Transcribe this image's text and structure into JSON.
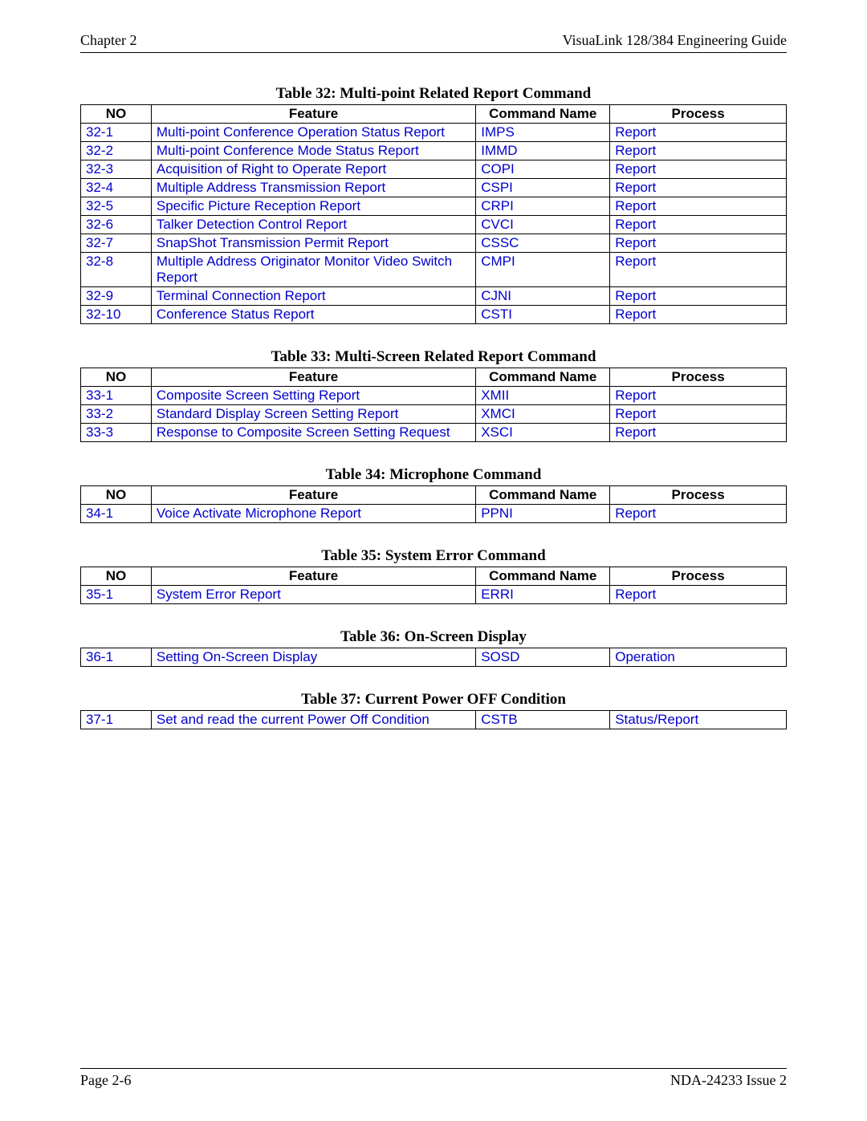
{
  "header": {
    "left": "Chapter 2",
    "right": "VisuaLink 128/384 Engineering Guide"
  },
  "footer": {
    "left": "Page 2-6",
    "right": "NDA-24233 Issue 2"
  },
  "columns": {
    "no": "NO",
    "feature": "Feature",
    "cmd": "Command Name",
    "proc": "Process"
  },
  "tables": [
    {
      "caption": "Table 32:  Multi-point Related Report Command",
      "show_header": true,
      "rows": [
        {
          "no": "32-1",
          "feature": "Multi-point Conference Operation Status Report",
          "cmd": "IMPS",
          "proc": "Report"
        },
        {
          "no": "32-2",
          "feature": "Multi-point Conference Mode Status Report",
          "cmd": "IMMD",
          "proc": "Report"
        },
        {
          "no": "32-3",
          "feature": "Acquisition of Right to Operate Report",
          "cmd": "COPI",
          "proc": "Report"
        },
        {
          "no": "32-4",
          "feature": "Multiple Address Transmission Report",
          "cmd": "CSPI",
          "proc": "Report"
        },
        {
          "no": "32-5",
          "feature": "Specific Picture Reception Report",
          "cmd": "CRPI",
          "proc": "Report"
        },
        {
          "no": "32-6",
          "feature": "Talker Detection Control Report",
          "cmd": "CVCI",
          "proc": "Report"
        },
        {
          "no": "32-7",
          "feature": "SnapShot Transmission Permit Report",
          "cmd": "CSSC",
          "proc": "Report"
        },
        {
          "no": "32-8",
          "feature": "Multiple Address Originator Monitor Video Switch Report",
          "cmd": "CMPI",
          "proc": "Report"
        },
        {
          "no": "32-9",
          "feature": "Terminal Connection Report",
          "cmd": "CJNI",
          "proc": "Report"
        },
        {
          "no": "32-10",
          "feature": "Conference Status Report",
          "cmd": "CSTI",
          "proc": "Report"
        }
      ]
    },
    {
      "caption": "Table 33:  Multi-Screen Related Report Command",
      "show_header": true,
      "rows": [
        {
          "no": "33-1",
          "feature": "Composite Screen Setting Report",
          "cmd": "XMII",
          "proc": "Report"
        },
        {
          "no": "33-2",
          "feature": "Standard Display Screen Setting Report",
          "cmd": "XMCI",
          "proc": "Report"
        },
        {
          "no": "33-3",
          "feature": "Response to Composite Screen Setting Request",
          "cmd": "XSCI",
          "proc": "Report"
        }
      ]
    },
    {
      "caption": "Table 34:  Microphone Command",
      "show_header": true,
      "rows": [
        {
          "no": "34-1",
          "feature": "Voice Activate Microphone Report",
          "cmd": "PPNI",
          "proc": "Report"
        }
      ]
    },
    {
      "caption": "Table 35:  System Error Command",
      "show_header": true,
      "rows": [
        {
          "no": "35-1",
          "feature": "System Error Report",
          "cmd": "ERRI",
          "proc": "Report"
        }
      ]
    },
    {
      "caption": "Table 36:  On-Screen Display",
      "show_header": false,
      "rows": [
        {
          "no": "36-1",
          "feature": "Setting On-Screen Display",
          "cmd": "SOSD",
          "proc": "Operation"
        }
      ]
    },
    {
      "caption": "Table 37:  Current Power OFF Condition",
      "show_header": false,
      "rows": [
        {
          "no": "37-1",
          "feature": "Set and read the current Power Off Condition",
          "cmd": "CSTB",
          "proc": "Status/Report"
        }
      ]
    }
  ]
}
